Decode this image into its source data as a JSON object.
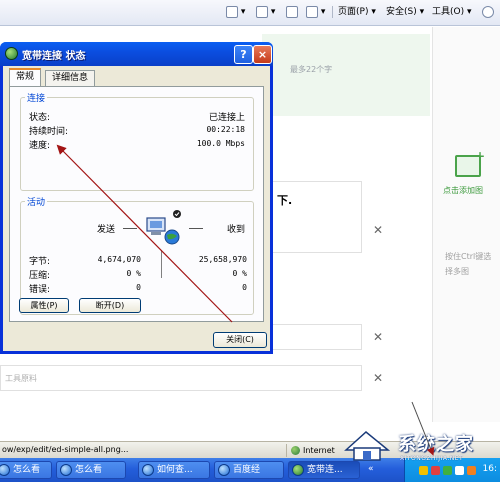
{
  "browser": {
    "toolbar": {
      "page_menu": "页面(P)",
      "safety_menu": "安全(S)",
      "tools_menu": "工具(O)"
    },
    "content": {
      "word_limit_hint": "最多22个字",
      "add_image_label": "点击添加图",
      "ctrl_tip": "按住Ctrl键选择多图",
      "editor_fragment": "下.",
      "field2_placeholder": "工具原料"
    },
    "status_bar": {
      "url": "ow/exp/edit/ed-simple-all.png...",
      "zone": "Internet"
    }
  },
  "taskbar": {
    "items": [
      {
        "label": "怎么看"
      },
      {
        "label": "怎么看"
      },
      {
        "label": "如何查..."
      },
      {
        "label": "百度经"
      },
      {
        "label": "宽带连..."
      }
    ],
    "clock": "16:"
  },
  "watermark": {
    "title": "系统之家",
    "subtitle": "XITONGZHIJIA.NET"
  },
  "dialog": {
    "title": "宽带连接 状态",
    "help": "?",
    "close": "×",
    "tabs": [
      "常规",
      "详细信息"
    ],
    "connection": {
      "title": "连接",
      "status_label": "状态:",
      "status_value": "已连接上",
      "duration_label": "持续时间:",
      "duration_value": "00:22:18",
      "speed_label": "速度:",
      "speed_value": "100.0 Mbps"
    },
    "activity": {
      "title": "活动",
      "sent_label": "发送",
      "received_label": "收到",
      "bytes_label": "字节:",
      "bytes_sent": "4,674,070",
      "bytes_received": "25,658,970",
      "compression_label": "压缩:",
      "compression_sent": "0 %",
      "compression_received": "0 %",
      "errors_label": "错误:",
      "errors_sent": "0",
      "errors_received": "0"
    },
    "buttons": {
      "properties": "属性(P)",
      "disconnect": "断开(D)",
      "close": "关闭(C)"
    }
  },
  "annotation": {
    "arrow_color": "#a31515"
  }
}
